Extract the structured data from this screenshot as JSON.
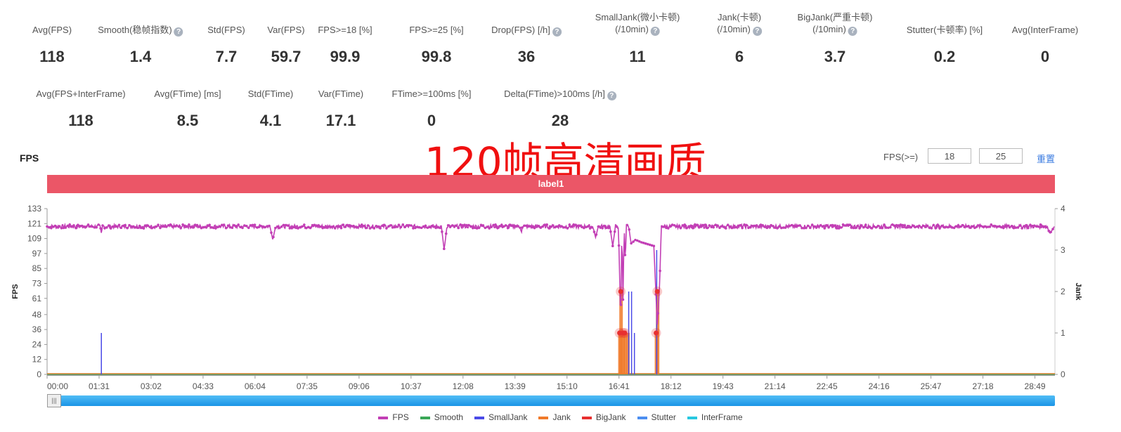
{
  "metrics_row1": [
    {
      "label": "Avg(FPS)",
      "value": "118",
      "help": false
    },
    {
      "label": "Smooth(稳帧指数)",
      "value": "1.4",
      "help": true
    },
    {
      "label": "Std(FPS)",
      "value": "7.7",
      "help": false
    },
    {
      "label": "Var(FPS)",
      "value": "59.7",
      "help": false
    },
    {
      "label": "FPS>=18 [%]",
      "value": "99.9",
      "help": false
    },
    {
      "label": "FPS>=25 [%]",
      "value": "99.8",
      "help": false
    },
    {
      "label": "Drop(FPS) [/h]",
      "value": "36",
      "help": true
    },
    {
      "label": "SmallJank(微小卡顿)",
      "label2": "(/10min)",
      "value": "11",
      "help": true
    },
    {
      "label": "Jank(卡顿)",
      "label2": "(/10min)",
      "value": "6",
      "help": true
    },
    {
      "label": "BigJank(严重卡顿)",
      "label2": "(/10min)",
      "value": "3.7",
      "help": true
    },
    {
      "label": "Stutter(卡顿率) [%]",
      "value": "0.2",
      "help": false
    },
    {
      "label": "Avg(InterFrame)",
      "value": "0",
      "help": false
    }
  ],
  "metrics_row2": [
    {
      "label": "Avg(FPS+InterFrame)",
      "value": "118",
      "help": false
    },
    {
      "label": "Avg(FTime) [ms]",
      "value": "8.5",
      "help": false
    },
    {
      "label": "Std(FTime)",
      "value": "4.1",
      "help": false
    },
    {
      "label": "Var(FTime)",
      "value": "17.1",
      "help": false
    },
    {
      "label": "FTime>=100ms [%]",
      "value": "0",
      "help": false
    },
    {
      "label": "Delta(FTime)>100ms [/h]",
      "value": "28",
      "help": true
    }
  ],
  "overlay_text": "120帧高清画质",
  "chart_header": {
    "title": "FPS",
    "threshold_label": "FPS(>=)",
    "threshold1": "18",
    "threshold2": "25",
    "reset_label": "重置"
  },
  "band_label": "label1",
  "help_icon": "question-circle-icon",
  "colors": {
    "FPS": "#c23fb5",
    "Smooth": "#3aa757",
    "SmallJank": "#4a4ae8",
    "Jank": "#f07a2a",
    "BigJank": "#e83030",
    "Stutter": "#4c8ef0",
    "InterFrame": "#28c8e0",
    "band": "#eb5667",
    "slider": "#2fa6ee"
  },
  "chart_data": {
    "type": "line",
    "ylabel": "FPS",
    "y2label": "Jank",
    "ylim": [
      0,
      133
    ],
    "y2lim": [
      0,
      4
    ],
    "yticks": [
      "0",
      "12",
      "24",
      "36",
      "48",
      "61",
      "73",
      "85",
      "97",
      "109",
      "121",
      "133"
    ],
    "y2ticks": [
      "0",
      "1",
      "2",
      "3",
      "4"
    ],
    "xticks": [
      "00:00",
      "01:31",
      "03:02",
      "04:33",
      "06:04",
      "07:35",
      "09:06",
      "10:37",
      "12:08",
      "13:39",
      "15:10",
      "16:41",
      "18:12",
      "19:43",
      "21:14",
      "22:45",
      "24:16",
      "25:47",
      "27:18",
      "28:49"
    ],
    "xlim": [
      "00:00",
      "29:24"
    ],
    "legend": [
      "FPS",
      "Smooth",
      "SmallJank",
      "Jank",
      "BigJank",
      "Stutter",
      "InterFrame"
    ],
    "legend_position": "bottom",
    "fps_keypoints": [
      [
        "00:00",
        119
      ],
      [
        "01:33",
        119
      ],
      [
        "01:35",
        113
      ],
      [
        "01:37",
        119
      ],
      [
        "06:30",
        119
      ],
      [
        "06:35",
        108
      ],
      [
        "06:40",
        119
      ],
      [
        "11:30",
        119
      ],
      [
        "11:35",
        100
      ],
      [
        "11:40",
        119
      ],
      [
        "13:48",
        119
      ],
      [
        "13:50",
        113
      ],
      [
        "13:52",
        119
      ],
      [
        "15:55",
        119
      ],
      [
        "16:00",
        110
      ],
      [
        "16:05",
        119
      ],
      [
        "16:25",
        119
      ],
      [
        "16:30",
        103
      ],
      [
        "16:35",
        119
      ],
      [
        "16:40",
        119
      ],
      [
        "16:42",
        80
      ],
      [
        "16:44",
        40
      ],
      [
        "16:46",
        119
      ],
      [
        "16:48",
        60
      ],
      [
        "16:50",
        119
      ],
      [
        "16:52",
        90
      ],
      [
        "16:54",
        119
      ],
      [
        "16:58",
        119
      ],
      [
        "17:02",
        105
      ],
      [
        "17:10",
        108
      ],
      [
        "17:20",
        106
      ],
      [
        "17:35",
        104
      ],
      [
        "17:42",
        103
      ],
      [
        "17:46",
        60
      ],
      [
        "17:48",
        40
      ],
      [
        "17:52",
        70
      ],
      [
        "17:55",
        119
      ],
      [
        "29:10",
        119
      ],
      [
        "29:15",
        113
      ],
      [
        "29:24",
        119
      ]
    ],
    "smalljank_events": [
      [
        "01:35",
        1
      ],
      [
        "16:58",
        2
      ],
      [
        "17:03",
        2
      ],
      [
        "17:08",
        1
      ],
      [
        "17:47",
        3
      ]
    ],
    "jank_events": [
      [
        "16:42",
        1
      ],
      [
        "16:44",
        2
      ],
      [
        "16:48",
        1
      ],
      [
        "16:51",
        1
      ],
      [
        "16:56",
        1
      ],
      [
        "17:46",
        1
      ],
      [
        "17:48",
        2
      ]
    ],
    "bigjank_events": [
      [
        "16:42",
        1
      ],
      [
        "16:44",
        2
      ],
      [
        "16:48",
        1
      ],
      [
        "16:51",
        1
      ],
      [
        "17:46",
        1
      ],
      [
        "17:48",
        2
      ]
    ]
  }
}
